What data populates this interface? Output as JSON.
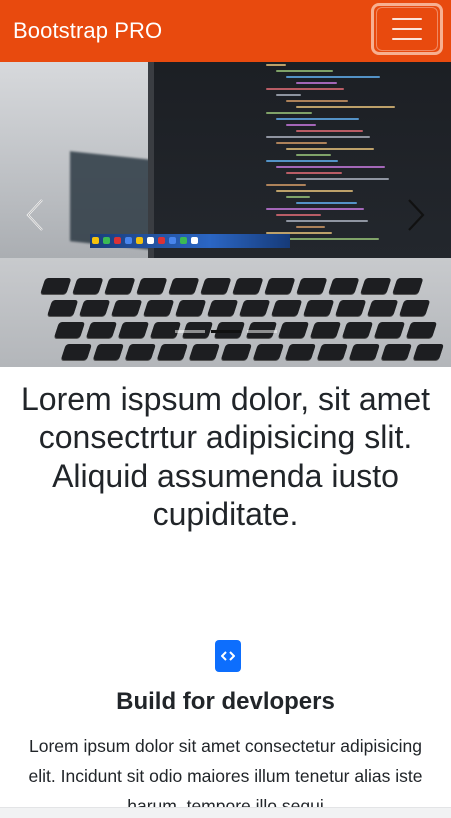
{
  "navbar": {
    "brand": "Bootstrap PRO",
    "accent_color": "#e84a0e",
    "toggler_icon": "hamburger-menu-icon"
  },
  "carousel": {
    "image_subject": "laptop with code on screen",
    "prev_icon": "chevron-left-icon",
    "next_icon": "chevron-right-icon",
    "slide_count": 3,
    "active_slide": 2
  },
  "lead": {
    "text": "Lorem ispsum dolor, sit amet consectrtur adipisicing slit. Aliquid assumenda iusto cupiditate."
  },
  "feature": {
    "icon": "code-icon",
    "icon_color": "#0d6efd",
    "title": "Build for devlopers",
    "text": "Lorem ipsum dolor sit amet consectetur adipisicing elit. Incidunt sit odio maiores illum tenetur alias iste harum, tempore illo sequi"
  }
}
